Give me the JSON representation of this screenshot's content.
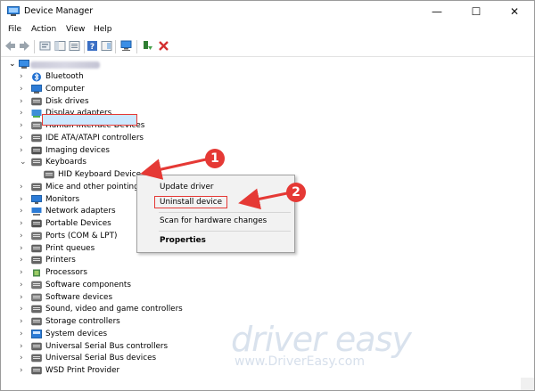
{
  "window": {
    "title": "Device Manager",
    "controls": [
      "—",
      "☐",
      "✕"
    ]
  },
  "menu": [
    "File",
    "Action",
    "View",
    "Help"
  ],
  "tree": [
    {
      "label": "Bluetooth",
      "expander": "›",
      "icon": "bluetooth-icon",
      "color": "#1f6fd1"
    },
    {
      "label": "Computer",
      "expander": "›",
      "icon": "computer-icon",
      "color": "#2c7bd6"
    },
    {
      "label": "Disk drives",
      "expander": "›",
      "icon": "disk-drive-icon",
      "color": "#6b6b6b"
    },
    {
      "label": "Display adapters",
      "expander": "›",
      "icon": "display-adapter-icon",
      "color": "#3d8fd8"
    },
    {
      "label": "Human Interface Devices",
      "expander": "›",
      "icon": "hid-icon",
      "color": "#7a7a7a"
    },
    {
      "label": "IDE ATA/ATAPI controllers",
      "expander": "›",
      "icon": "ide-controller-icon",
      "color": "#6b6b6b"
    },
    {
      "label": "Imaging devices",
      "expander": "›",
      "icon": "camera-icon",
      "color": "#555555"
    },
    {
      "label": "Keyboards",
      "expander": "⌄",
      "icon": "keyboard-icon",
      "color": "#6e6e6e"
    },
    {
      "label": "HID Keyboard Device",
      "expander": "",
      "icon": "keyboard-icon",
      "color": "#6e6e6e",
      "child": true
    },
    {
      "label": "Mice and other pointing devices",
      "expander": "›",
      "icon": "mouse-icon",
      "color": "#6b6b6b"
    },
    {
      "label": "Monitors",
      "expander": "›",
      "icon": "monitor-icon",
      "color": "#2c7bd6"
    },
    {
      "label": "Network adapters",
      "expander": "›",
      "icon": "network-adapter-icon",
      "color": "#2c7bd6"
    },
    {
      "label": "Portable Devices",
      "expander": "›",
      "icon": "portable-device-icon",
      "color": "#555555"
    },
    {
      "label": "Ports (COM & LPT)",
      "expander": "›",
      "icon": "port-icon",
      "color": "#777777"
    },
    {
      "label": "Print queues",
      "expander": "›",
      "icon": "printer-icon",
      "color": "#666666"
    },
    {
      "label": "Printers",
      "expander": "›",
      "icon": "printer-icon",
      "color": "#666666"
    },
    {
      "label": "Processors",
      "expander": "›",
      "icon": "processor-icon",
      "color": "#4a8a4a"
    },
    {
      "label": "Software components",
      "expander": "›",
      "icon": "software-component-icon",
      "color": "#7a7a7a"
    },
    {
      "label": "Software devices",
      "expander": "›",
      "icon": "software-device-icon",
      "color": "#7a7a7a"
    },
    {
      "label": "Sound, video and game controllers",
      "expander": "›",
      "icon": "sound-icon",
      "color": "#6b6b6b"
    },
    {
      "label": "Storage controllers",
      "expander": "›",
      "icon": "storage-controller-icon",
      "color": "#6b6b6b"
    },
    {
      "label": "System devices",
      "expander": "›",
      "icon": "system-device-icon",
      "color": "#2c7bd6"
    },
    {
      "label": "Universal Serial Bus controllers",
      "expander": "›",
      "icon": "usb-icon",
      "color": "#6b6b6b"
    },
    {
      "label": "Universal Serial Bus devices",
      "expander": "›",
      "icon": "usb-icon",
      "color": "#6b6b6b"
    },
    {
      "label": "WSD Print Provider",
      "expander": "›",
      "icon": "printer-icon",
      "color": "#666666"
    }
  ],
  "context_menu": {
    "update": "Update driver",
    "uninstall": "Uninstall device",
    "scan": "Scan for hardware changes",
    "properties": "Properties"
  },
  "callouts": {
    "one": "1",
    "two": "2"
  },
  "watermark": {
    "brand": "driver easy",
    "url": "www.DriverEasy.com"
  },
  "colors": {
    "annotation": "#e53935",
    "selection": "#cce8ff"
  }
}
